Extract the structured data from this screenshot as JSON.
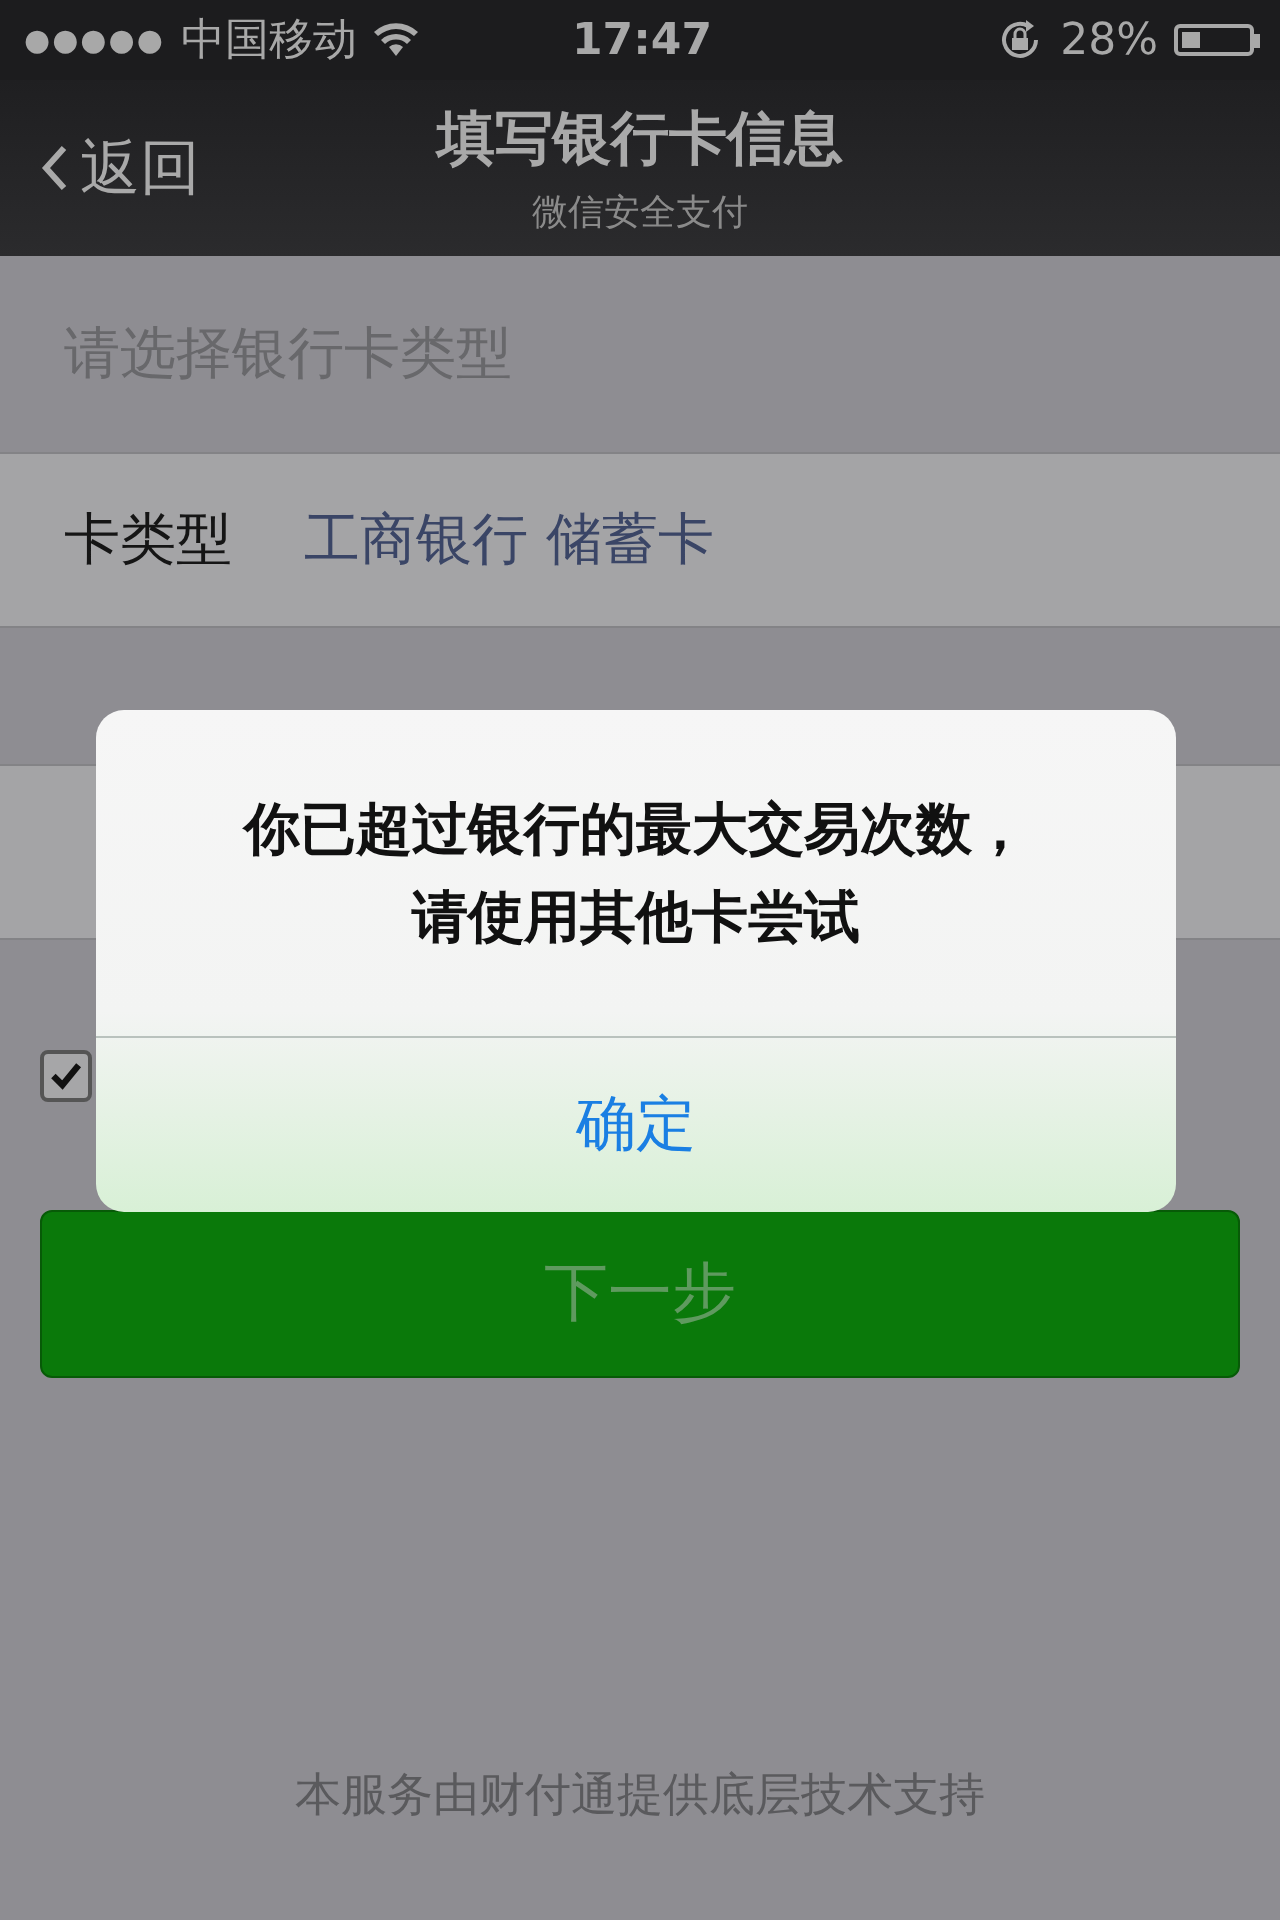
{
  "status_bar": {
    "signal_dots": "●●●●●",
    "carrier": "中国移动",
    "time": "17:47",
    "battery_text": "28%",
    "battery": {
      "level": 0.28
    }
  },
  "nav": {
    "back": "返回",
    "title": "填写银行卡信息",
    "subtitle": "微信安全支付"
  },
  "section_header": "请选择银行卡类型",
  "rows": [
    {
      "label": "卡类型",
      "value": "工商银行 储蓄卡"
    }
  ],
  "agreement": {
    "checked": true
  },
  "next_button": "下一步",
  "footer": "本服务由财付通提供底层技术支持",
  "alert": {
    "message_lines": [
      "你已超过银行的最大交易次数，",
      "请使用其他卡尝试"
    ],
    "button": "确定"
  }
}
